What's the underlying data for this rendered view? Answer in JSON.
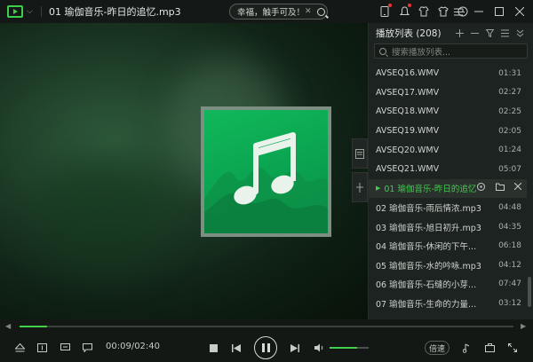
{
  "titlebar": {
    "title": "01 瑜伽音乐-昨日的追忆.mp3",
    "search_text": "幸福，触手可及！",
    "clear_glyph": "✕"
  },
  "icons": {
    "logo": "player-logo-icon",
    "menu_arrow": "chevron-down-icon"
  },
  "colors": {
    "accent": "#3ecf4a",
    "album_green": "#10b85a",
    "panel_bg": "#1d2320"
  },
  "playlist": {
    "title": "播放列表 (208)",
    "search_placeholder": "搜索播放列表...",
    "items": [
      {
        "name": "AVSEQ16.WMV",
        "duration": "01:31"
      },
      {
        "name": "AVSEQ17.WMV",
        "duration": "02:27"
      },
      {
        "name": "AVSEQ18.WMV",
        "duration": "02:25"
      },
      {
        "name": "AVSEQ19.WMV",
        "duration": "02:05"
      },
      {
        "name": "AVSEQ20.WMV",
        "duration": "01:24"
      },
      {
        "name": "AVSEQ21.WMV",
        "duration": "05:07"
      },
      {
        "name": "01 瑜伽音乐-昨日的追忆...",
        "duration": ""
      },
      {
        "name": "02 瑜伽音乐-雨后情浓.mp3",
        "duration": "04:48"
      },
      {
        "name": "03 瑜伽音乐-旭日初升.mp3",
        "duration": "04:35"
      },
      {
        "name": "04 瑜伽音乐-休闲的下午...",
        "duration": "06:18"
      },
      {
        "name": "05 瑜伽音乐-水的吟咏.mp3",
        "duration": "04:12"
      },
      {
        "name": "06 瑜伽音乐-石缝的小芽...",
        "duration": "07:47"
      },
      {
        "name": "07 瑜伽音乐-生命的力量...",
        "duration": "03:12"
      }
    ],
    "active_index": 6
  },
  "controls": {
    "time": "00:09/02:40",
    "speed_label": "倍速",
    "progress": 0.056,
    "volume": 0.7
  }
}
